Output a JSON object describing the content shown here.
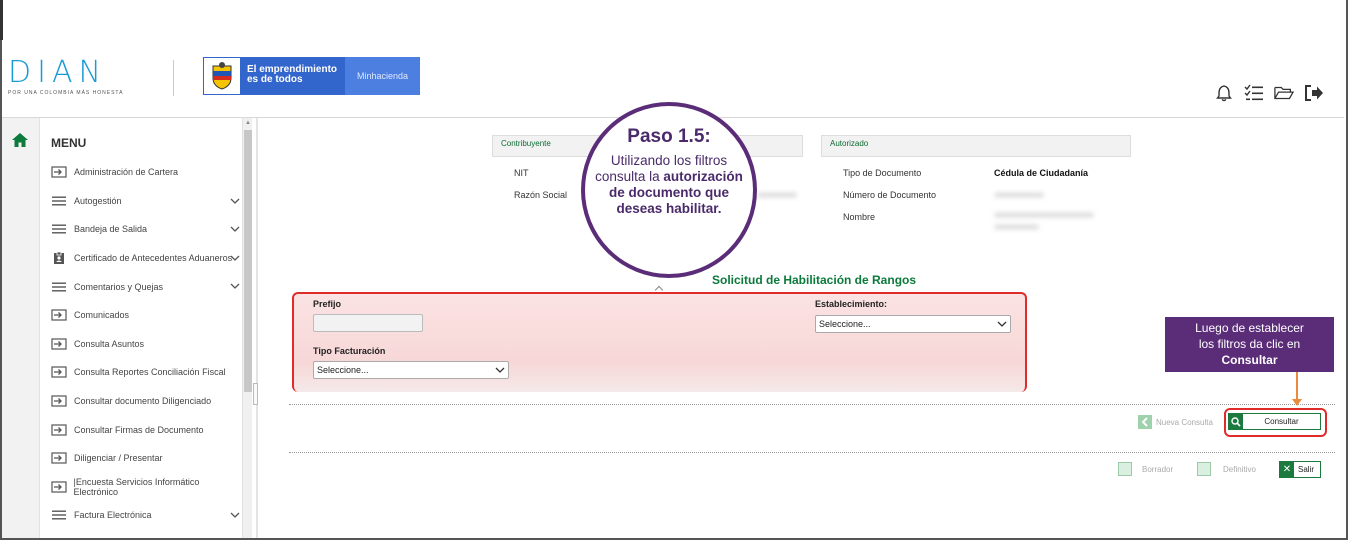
{
  "header": {
    "logo_text": "DIAN",
    "logo_slogan": "POR UNA COLOMBIA MÁS HONESTA",
    "gov_line1": "El emprendimiento",
    "gov_line2": "es de todos",
    "gov_ministry": "Minhacienda",
    "icons": [
      "bell-icon",
      "list-check-icon",
      "folder-open-icon",
      "logout-icon"
    ]
  },
  "sidebar": {
    "title": "MENU",
    "items": [
      {
        "label": "Administración de Cartera",
        "icon": "enter-icon",
        "expand": false
      },
      {
        "label": "Autogestión",
        "icon": "hamburger-icon",
        "expand": true
      },
      {
        "label": "Bandeja de Salida",
        "icon": "hamburger-icon",
        "expand": true
      },
      {
        "label": "Certificado de Antecedentes Aduaneros",
        "icon": "clipboard-icon",
        "expand": true
      },
      {
        "label": "Comentarios y Quejas",
        "icon": "hamburger-icon",
        "expand": true
      },
      {
        "label": "Comunicados",
        "icon": "enter-icon",
        "expand": false
      },
      {
        "label": "Consulta Asuntos",
        "icon": "enter-icon",
        "expand": false
      },
      {
        "label": "Consulta Reportes Conciliación Fiscal",
        "icon": "enter-icon",
        "expand": false
      },
      {
        "label": "Consultar documento Diligenciado",
        "icon": "enter-icon",
        "expand": false
      },
      {
        "label": "Consultar Firmas de Documento",
        "icon": "enter-icon",
        "expand": false
      },
      {
        "label": "Diligenciar / Presentar",
        "icon": "enter-icon",
        "expand": false
      },
      {
        "label": "|Encuesta Servicios Informático Electrónico",
        "icon": "enter-icon",
        "expand": false
      },
      {
        "label": "Factura Electrónica",
        "icon": "hamburger-icon",
        "expand": true
      }
    ]
  },
  "contribuyente": {
    "header": "Contribuyente",
    "nit_label": "NIT",
    "razon_label": "Razón Social"
  },
  "autorizado": {
    "header": "Autorizado",
    "tipo_label": "Tipo de Documento",
    "tipo_value": "Cédula de Ciudadanía",
    "numero_label": "Número de Documento",
    "nombre_label": "Nombre"
  },
  "form": {
    "title": "Solicitud de Habilitación de Rangos",
    "prefijo_label": "Prefijo",
    "prefijo_value": "",
    "establecimiento_label": "Establecimiento:",
    "establecimiento_value": "Seleccione...",
    "tipo_facturacion_label": "Tipo Facturación",
    "tipo_facturacion_value": "Seleccione..."
  },
  "actions": {
    "nueva_consulta": "Nueva Consulta",
    "consultar": "Consultar",
    "borrador": "Borrador",
    "definitivo": "Definitivo",
    "salir": "Salir"
  },
  "callout": {
    "title": "Paso 1.5:",
    "line1": "Utilizando los filtros consulta la",
    "bold": "autorización de documento que deseas habilitar."
  },
  "tip": {
    "line1": "Luego de establecer",
    "line2": "los filtros da clic en",
    "bold": "Consultar"
  },
  "colors": {
    "brand_green": "#0b7a3b",
    "callout_purple": "#5b2d79",
    "highlight_red": "#e02b2b",
    "arrow_orange": "#e98b3a"
  }
}
